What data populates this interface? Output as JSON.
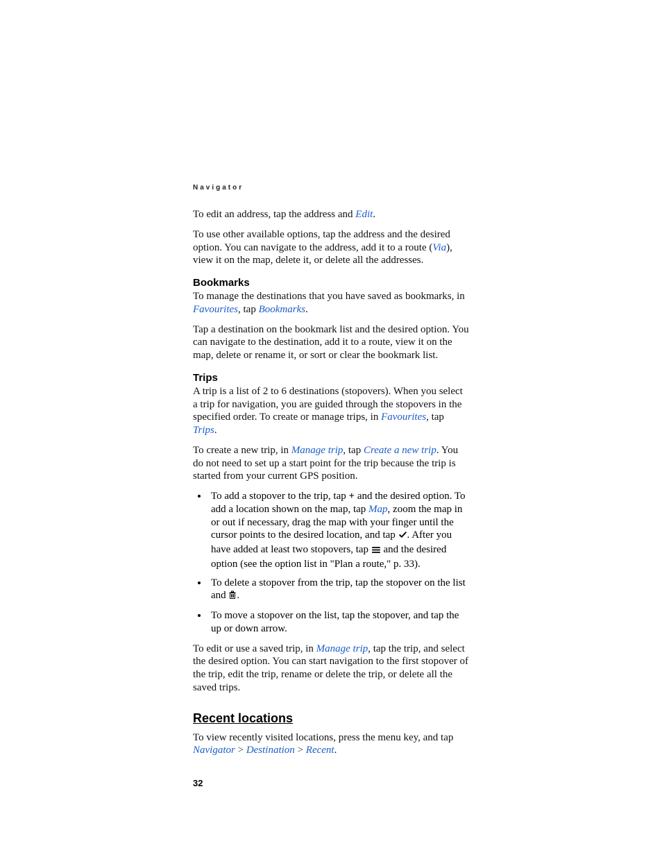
{
  "header": {
    "running": "Navigator"
  },
  "p_edit_address_a": "To edit an address, tap the address and ",
  "kw_edit": "Edit",
  "p_edit_address_b": ".",
  "p_options_a": "To use other available options, tap the address and the desired option. You can navigate to the address, add it to a route (",
  "kw_via": "Via",
  "p_options_b": "), view it on the map, delete it, or delete all the addresses.",
  "h_bookmarks": "Bookmarks",
  "p_bookmarks_a": "To manage the destinations that you have saved as bookmarks, in ",
  "kw_favourites": "Favourites",
  "p_bookmarks_b": ", tap ",
  "kw_bookmarks": "Bookmarks",
  "p_bookmarks_c": ".",
  "p_bookmarks_tap": "Tap a destination on the bookmark list and the desired option. You can navigate to the destination, add it to a route, view it on the map, delete or rename it, or sort or clear the bookmark list.",
  "h_trips": "Trips",
  "p_trips_intro_a": "A trip is a list of 2 to 6 destinations (stopovers). When you select a trip for navigation, you are guided through the stopovers in the specified order. To create or manage trips, in ",
  "p_trips_intro_b": ", tap ",
  "kw_trips": "Trips",
  "p_trips_intro_c": ".",
  "p_newtrip_a": "To create a new trip, in ",
  "kw_manage_trip": "Manage trip",
  "p_newtrip_b": ", tap ",
  "kw_create_new_trip": "Create a new trip",
  "p_newtrip_c": ". You do not need to set up a start point for the trip because the trip is started from your current GPS position.",
  "li1_a": "To add a stopover to the trip, tap ",
  "li1_plus": "+",
  "li1_b": " and the desired option. To add a location shown on the map, tap ",
  "kw_map": "Map",
  "li1_c": ", zoom the map in or out if necessary, drag the map with your finger until the cursor points to the desired location, and tap ",
  "li1_d": ". After you have added at least two stopovers, tap ",
  "li1_e": " and the desired option (see the option list in \"Plan a route,\" p. 33).",
  "li2_a": "To delete a stopover from the trip, tap the stopover on the list and ",
  "li2_b": ".",
  "li3": "To move a stopover on the list, tap the stopover, and tap the up or down arrow.",
  "p_editsaved_a": "To edit or use a saved trip, in ",
  "p_editsaved_b": ", tap the trip, and select the desired option. You can start navigation to the first stopover of the trip, edit the trip, rename or delete the trip, or delete all the saved trips.",
  "h_recent": "Recent locations",
  "p_recent_a": "To view recently visited locations, press the menu key, and tap ",
  "kw_navigator": "Navigator",
  "chev": " > ",
  "kw_destination": "Destination",
  "kw_recent": "Recent",
  "p_recent_b": ".",
  "pagenum": "32"
}
